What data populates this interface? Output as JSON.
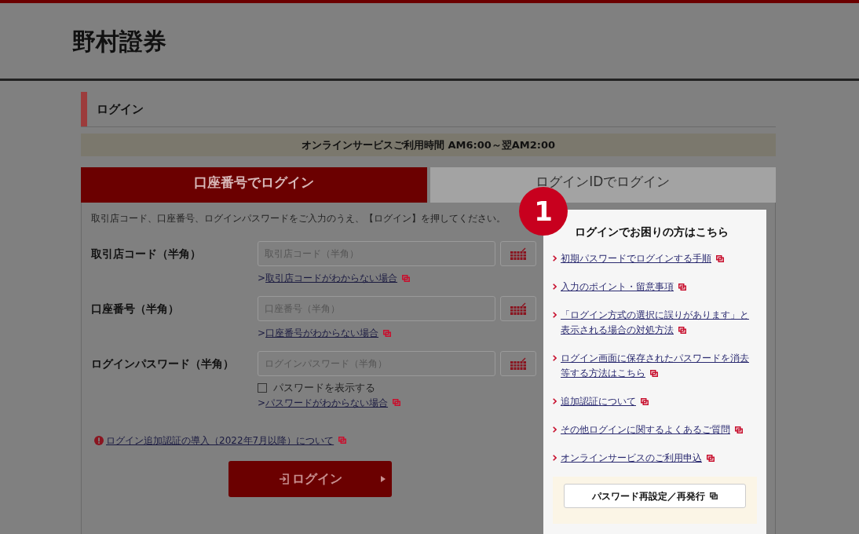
{
  "header": {
    "logo": "野村證券"
  },
  "page_title": "ログイン",
  "hours_banner": "オンラインサービスご利用時間 AM6:00～翌AM2:00",
  "tabs": [
    {
      "label": "口座番号でログイン",
      "selected": true
    },
    {
      "label": "ログインIDでログイン",
      "selected": false
    }
  ],
  "form": {
    "instructions": "取引店コード、口座番号、ログインパスワードをご入力のうえ、【ログイン】を押してください。",
    "fields": [
      {
        "label": "取引店コード（半角）",
        "placeholder": "取引店コード（半角）",
        "link_prefix": ">",
        "help_link": "取引店コードがわからない場合"
      },
      {
        "label": "口座番号（半角）",
        "placeholder": "口座番号（半角）",
        "link_prefix": ">",
        "help_link": "口座番号がわからない場合"
      },
      {
        "label": "ログインパスワード（半角）",
        "placeholder": "ログインパスワード（半角）",
        "show_password": {
          "label": "パスワードを表示する",
          "checked": false
        },
        "link_prefix": ">",
        "help_link": "パスワードがわからない場合"
      }
    ],
    "notice_link": "ログイン追加認証の導入（2022年7月以降）について",
    "login_button": "ログイン"
  },
  "help": {
    "badge": "1",
    "title": "ログインでお困りの方はこちら",
    "links": [
      "初期パスワードでログインする手順",
      "入力のポイント・留意事項",
      "「ログイン方式の選択に誤りがあります」と表示される場合の対処方法",
      "ログイン画面に保存されたパスワードを消去等する方法はこちら",
      "追加認証について",
      "その他ログインに関するよくあるご質問",
      "オンラインサービスのご利用申込"
    ],
    "reset_button": "パスワード再設定／再発行"
  }
}
